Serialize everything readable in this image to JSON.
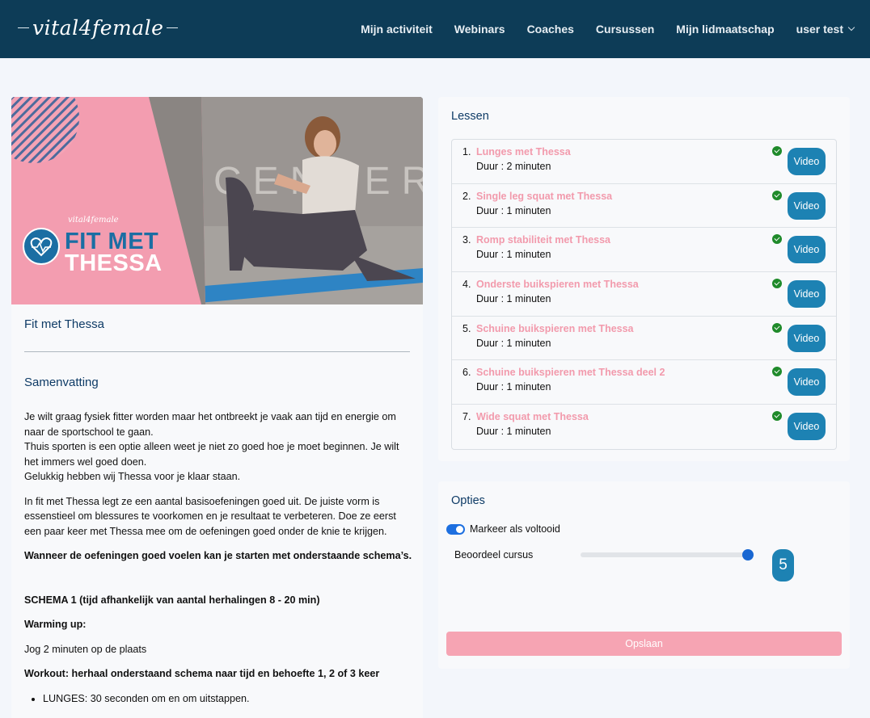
{
  "header": {
    "logo_text": "vital4female",
    "nav": [
      {
        "label": "Mijn activiteit"
      },
      {
        "label": "Webinars"
      },
      {
        "label": "Coaches"
      },
      {
        "label": "Cursussen"
      },
      {
        "label": "Mijn lidmaatschap"
      }
    ],
    "user_menu": "user test"
  },
  "course": {
    "banner": {
      "brand": "vital4female",
      "line1": "FIT MET",
      "line2": "THESSA",
      "wall_text": "CENTER"
    },
    "title": "Fit met Thessa",
    "summary_heading": "Samenvatting",
    "paragraphs": {
      "p1_l1": "Je wilt graag fysiek fitter worden maar het ontbreekt je vaak aan tijd en energie om naar de sportschool te gaan.",
      "p1_l2": "Thuis sporten is een optie alleen weet je niet zo goed hoe je moet beginnen. Je wilt het immers wel goed doen.",
      "p1_l3": "Gelukkig hebben wij Thessa voor je klaar staan.",
      "p2": "In fit met Thessa legt ze een aantal basisoefeningen goed uit. De juiste vorm is essenstieel om blessures te voorkomen en je resultaat te verbeteren. Doe ze eerst een paar keer met Thessa mee om de oefeningen goed onder de knie te krijgen.",
      "p3": "Wanneer de oefeningen goed voelen kan je starten met onderstaande schema’s.",
      "schema": "SCHEMA 1 (tijd afhankelijk van aantal herhalingen 8 - 20 min)",
      "warmup_heading": "Warming up:",
      "warmup": "Jog 2 minuten op de plaats",
      "workout_heading": "Workout: herhaal onderstaand schema naar tijd en behoefte 1, 2 of 3 keer",
      "workout_items": [
        "LUNGES: 30 seconden om en om uitstappen."
      ]
    }
  },
  "lessons": {
    "heading": "Lessen",
    "video_label": "Video",
    "items": [
      {
        "num": "1.",
        "title": "Lunges met Thessa",
        "duration": "Duur : 2 minuten"
      },
      {
        "num": "2.",
        "title": "Single leg squat met Thessa",
        "duration": "Duur : 1 minuten"
      },
      {
        "num": "3.",
        "title": "Romp stabiliteit met Thessa",
        "duration": "Duur : 1 minuten"
      },
      {
        "num": "4.",
        "title": "Onderste buikspieren met Thessa",
        "duration": "Duur : 1 minuten"
      },
      {
        "num": "5.",
        "title": "Schuine buikspieren met Thessa",
        "duration": "Duur : 1 minuten"
      },
      {
        "num": "6.",
        "title": "Schuine buikspieren met Thessa deel 2",
        "duration": "Duur : 1 minuten"
      },
      {
        "num": "7.",
        "title": "Wide squat met Thessa",
        "duration": "Duur : 1 minuten"
      }
    ]
  },
  "options": {
    "heading": "Opties",
    "toggle_label": "Markeer als voltooid",
    "toggle_on": true,
    "rating_label": "Beoordeel cursus",
    "rating_value": "5",
    "rating_fraction": 1.0,
    "save_label": "Opslaan"
  },
  "colors": {
    "header_bg": "#0d3c57",
    "accent_blue": "#1d82b3",
    "pink": "#f29aac",
    "save_button": "#f6a4b3"
  }
}
